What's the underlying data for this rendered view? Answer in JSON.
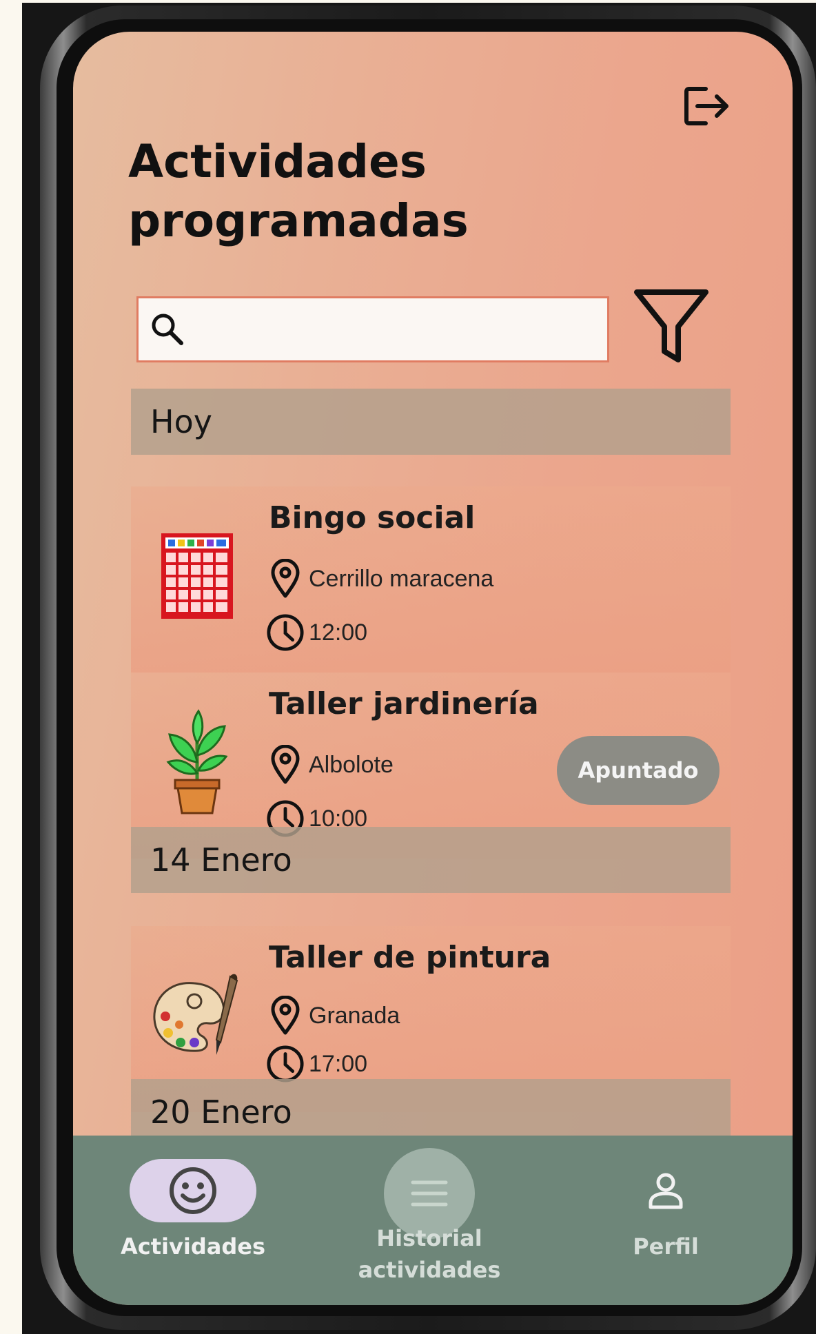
{
  "header": {
    "title_line1": "Actividades",
    "title_line2": "programadas",
    "logout_icon": "logout-icon"
  },
  "search": {
    "value": "",
    "placeholder": "",
    "icon": "search-icon"
  },
  "filter": {
    "icon": "filter-icon"
  },
  "sections": [
    {
      "label": "Hoy"
    },
    {
      "label": "14 Enero"
    },
    {
      "label": "20 Enero"
    }
  ],
  "activities": [
    {
      "name": "Bingo social",
      "location": "Cerrillo maracena",
      "time": "12:00",
      "icon": "bingo-card-icon",
      "badge": ""
    },
    {
      "name": "Taller jardinería",
      "location": "Albolote",
      "time": "10:00",
      "icon": "potted-plant-icon",
      "badge": "Apuntado"
    },
    {
      "name": "Taller de pintura",
      "location": "Granada",
      "time": "17:00",
      "icon": "paint-palette-icon",
      "badge": ""
    }
  ],
  "bottom_nav": {
    "items": [
      {
        "label": "Actividades",
        "icon": "smiley-icon",
        "active": true
      },
      {
        "label_line1": "Historial",
        "label_line2": "actividades",
        "icon": "list-icon",
        "active": false
      },
      {
        "label": "Perfil",
        "icon": "person-icon",
        "active": false
      }
    ]
  },
  "colors": {
    "screen_gradient_start": "#e6bc9f",
    "screen_gradient_end": "#eb9f86",
    "section_bg": "#b2a08c",
    "badge_bg": "#8c8c85",
    "nav_bg": "#6e8679",
    "active_pill": "#ddd2ea",
    "search_border": "#e07c62"
  }
}
